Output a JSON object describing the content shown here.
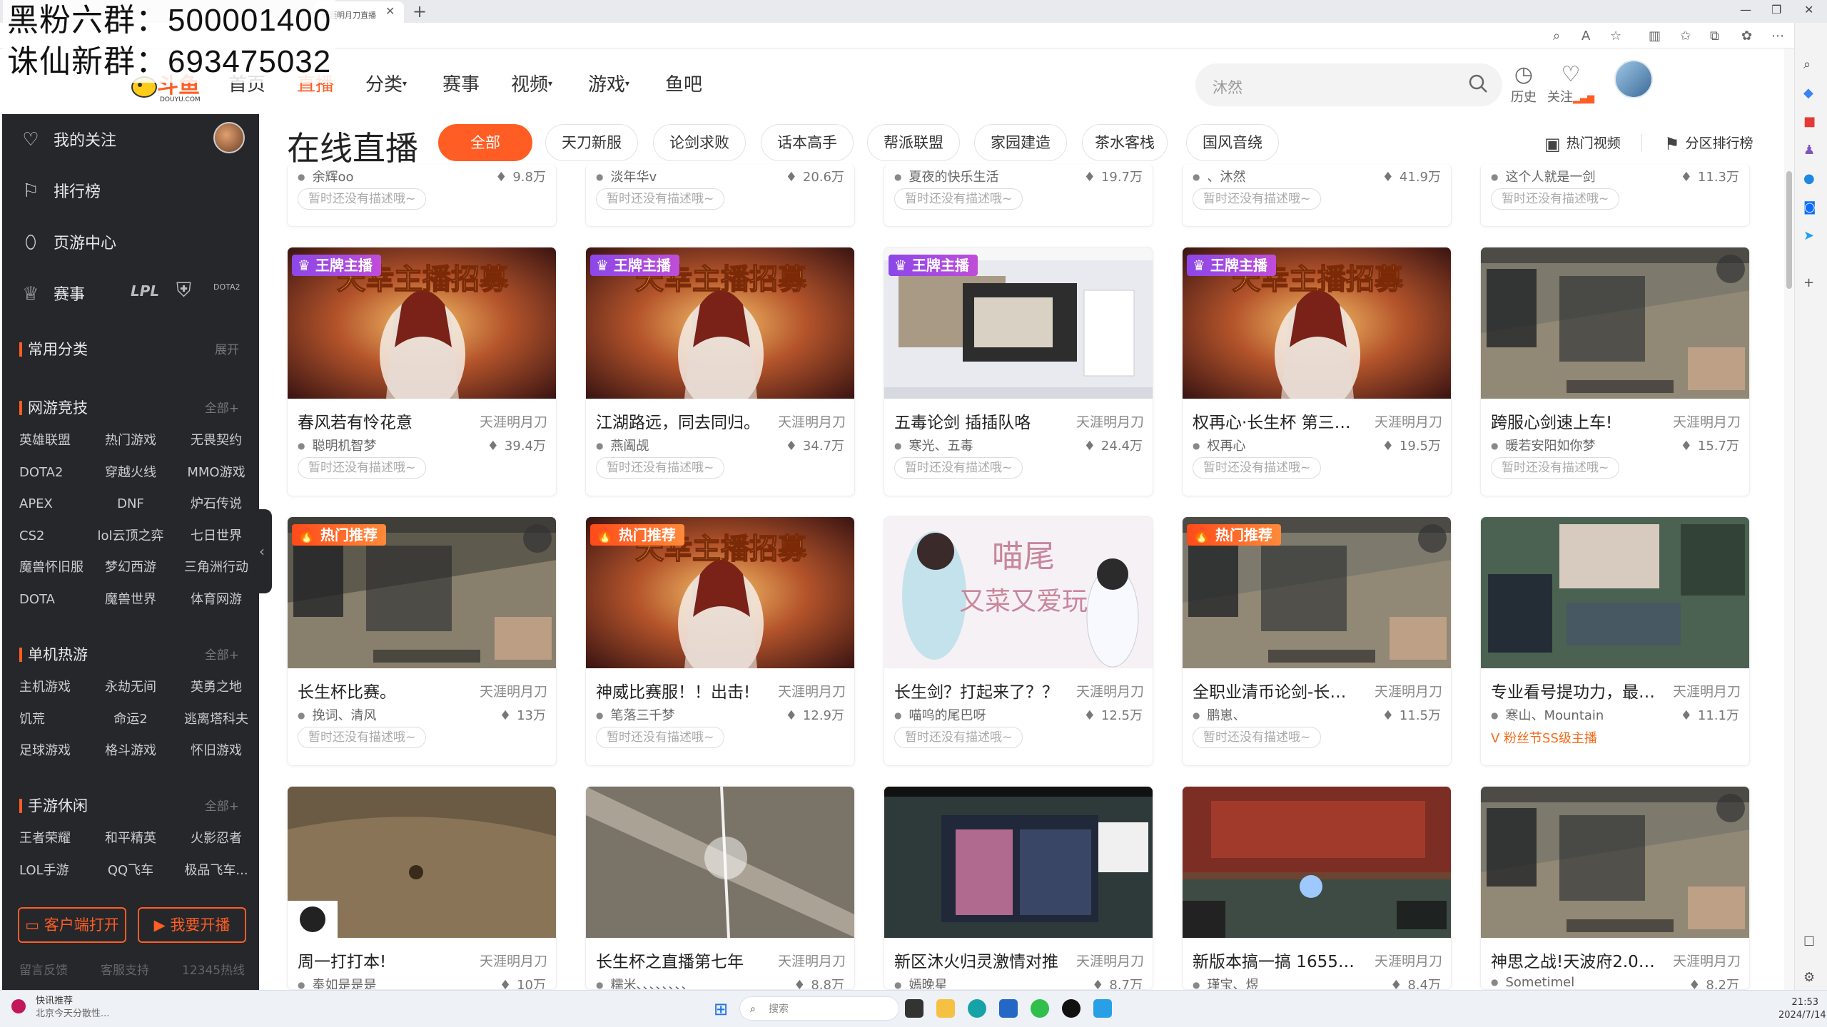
{
  "overlay": {
    "line1": "黑粉六群：500001400",
    "line2": "诛仙新群：693475032"
  },
  "browser": {
    "tab_title": "天涯明月刀直播"
  },
  "header": {
    "logo_text": "斗鱼",
    "logo_sub": "DOUYU.COM",
    "nav": [
      "首页",
      "直播",
      "分类",
      "赛事",
      "视频",
      "游戏",
      "鱼吧"
    ],
    "search_placeholder": "沐然",
    "history_label": "历史",
    "follow_label": "关注"
  },
  "sidebar": {
    "items": [
      "我的关注",
      "排行榜",
      "页游中心",
      "赛事"
    ],
    "esports_logos": [
      "LPL",
      "DOTA2"
    ],
    "common": {
      "title": "常用分类",
      "more": "展开"
    },
    "sections": [
      {
        "title": "网游竞技",
        "more": "全部+",
        "items": [
          "英雄联盟",
          "热门游戏",
          "无畏契约",
          "DOTA2",
          "穿越火线",
          "MMO游戏",
          "APEX",
          "DNF",
          "炉石传说",
          "CS2",
          "lol云顶之弈",
          "七日世界",
          "魔兽怀旧服",
          "梦幻西游",
          "三角洲行动",
          "DOTA",
          "魔兽世界",
          "体育网游"
        ]
      },
      {
        "title": "单机热游",
        "more": "全部+",
        "items": [
          "主机游戏",
          "永劫无间",
          "英勇之地",
          "饥荒",
          "命运2",
          "逃离塔科夫",
          "足球游戏",
          "格斗游戏",
          "怀旧游戏"
        ]
      },
      {
        "title": "手游休闲",
        "more": "全部+",
        "items": [
          "王者荣耀",
          "和平精英",
          "火影忍者",
          "LOL手游",
          "QQ飞车",
          "极品飞车..."
        ]
      }
    ],
    "client_btn": "客户端打开",
    "live_btn": "我要开播",
    "footer": [
      "留言反馈",
      "客服支持",
      "12345热线"
    ]
  },
  "content": {
    "title": "在线直播",
    "categories": [
      "全部",
      "天刀新服",
      "论剑求败",
      "话本高手",
      "帮派联盟",
      "家园建造",
      "茶水客栈",
      "国风音绕"
    ],
    "hot_video": "热门视频",
    "rank": "分区排行榜"
  },
  "top_row": [
    {
      "user": "余辉oo",
      "heat": "9.8万",
      "desc": "暂时还没有描述哦~"
    },
    {
      "user": "淡年华v",
      "heat": "20.6万",
      "desc": "暂时还没有描述哦~"
    },
    {
      "user": "夏夜的快乐生活",
      "heat": "19.7万",
      "desc": "暂时还没有描述哦~"
    },
    {
      "user": "、沐然",
      "heat": "41.9万",
      "desc": "暂时还没有描述哦~"
    },
    {
      "user": "这个人就是一剑",
      "heat": "11.3万",
      "desc": "暂时还没有描述哦~"
    }
  ],
  "cards": [
    {
      "badge": "王牌主播",
      "badge_type": "gold",
      "title": "春风若有怜花意",
      "cat": "天涯明月刀",
      "user": "聪明机智梦",
      "heat": "39.4万",
      "desc": "暂时还没有描述哦~"
    },
    {
      "badge": "王牌主播",
      "badge_type": "gold",
      "title": "江湖路远，同去同归。",
      "cat": "天涯明月刀",
      "user": "燕阖觇",
      "heat": "34.7万",
      "desc": "暂时还没有描述哦~"
    },
    {
      "badge": "王牌主播",
      "badge_type": "gold",
      "title": "五毒论剑 插插队咯",
      "cat": "天涯明月刀",
      "user": "寒光、五毒",
      "heat": "24.4万",
      "desc": "暂时还没有描述哦~"
    },
    {
      "badge": "王牌主播",
      "badge_type": "gold",
      "title": "权再心·长生杯 第三天 ...",
      "cat": "天涯明月刀",
      "user": "权再心",
      "heat": "19.5万",
      "desc": "暂时还没有描述哦~"
    },
    {
      "badge": "",
      "badge_type": "",
      "title": "跨服心剑速上车!",
      "cat": "天涯明月刀",
      "user": "暖若安阳如你梦",
      "heat": "15.7万",
      "desc": "暂时还没有描述哦~"
    },
    {
      "badge": "热门推荐",
      "badge_type": "hot",
      "title": "长生杯比赛。",
      "cat": "天涯明月刀",
      "user": "挽词、清风",
      "heat": "13万",
      "desc": "暂时还没有描述哦~"
    },
    {
      "badge": "热门推荐",
      "badge_type": "hot",
      "title": "神威比赛服！！出击!",
      "cat": "天涯明月刀",
      "user": "笔落三千梦",
      "heat": "12.9万",
      "desc": "暂时还没有描述哦~"
    },
    {
      "badge": "",
      "badge_type": "",
      "title": "长生剑？打起来了？？",
      "cat": "天涯明月刀",
      "user": "喵呜的尾巴呀",
      "heat": "12.5万",
      "desc": "暂时还没有描述哦~"
    },
    {
      "badge": "热门推荐",
      "badge_type": "hot",
      "title": "全职业清币论剑-长生杯...",
      "cat": "天涯明月刀",
      "user": "鹏崽、",
      "heat": "11.5万",
      "desc": "暂时还没有描述哦~"
    },
    {
      "badge": "",
      "badge_type": "",
      "title": "专业看号提功力，最强...",
      "cat": "天涯明月刀",
      "user": "寒山、Mountain",
      "heat": "11.1万",
      "desc": "",
      "fan": "V 粉丝节SS级主播"
    },
    {
      "badge": "",
      "badge_type": "",
      "title": "周一打打本!",
      "cat": "天涯明月刀",
      "user": "奉如是是是",
      "heat": "10万",
      "desc": ""
    },
    {
      "badge": "",
      "badge_type": "",
      "title": "长生杯之直播第七年",
      "cat": "天涯明月刀",
      "user": "糯米、、、、、、、、",
      "heat": "8.8万",
      "desc": ""
    },
    {
      "badge": "",
      "badge_type": "",
      "title": "新区沐火归灵激情对推",
      "cat": "天涯明月刀",
      "user": "嫣晚星",
      "heat": "8.7万",
      "desc": ""
    },
    {
      "badge": "",
      "badge_type": "",
      "title": "新版本搞一搞 1655196",
      "cat": "天涯明月刀",
      "user": "瑾宝、煜",
      "heat": "8.4万",
      "desc": ""
    },
    {
      "badge": "",
      "badge_type": "",
      "title": "神思之战!天波府2.0! ...",
      "cat": "天涯明月刀",
      "user": "Sometimel",
      "heat": "8.2万",
      "desc": ""
    }
  ],
  "thumb_styles": [
    "poster",
    "poster",
    "desktop",
    "poster",
    "game",
    "game2",
    "poster",
    "anime",
    "game",
    "stream",
    "desert",
    "slash",
    "ui",
    "temple",
    "game"
  ],
  "poster_text": "天幸主播招募",
  "anime_text": {
    "l1": "喵尾",
    "l2": "又菜又爱玩"
  },
  "taskbar": {
    "news_title": "快讯推荐",
    "news_sub": "北京今天分散性...",
    "search": "搜索",
    "time": "21:53",
    "date": "2024/7/14"
  }
}
